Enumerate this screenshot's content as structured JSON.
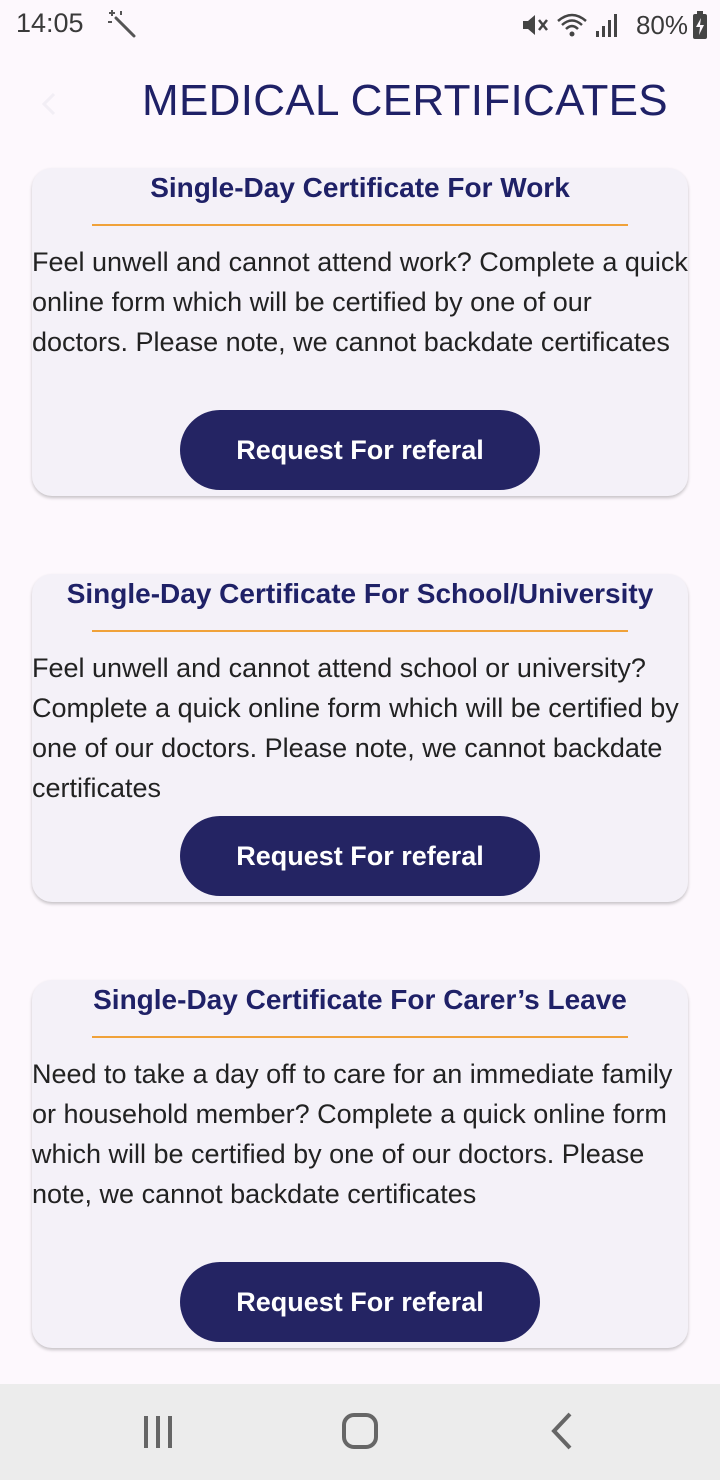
{
  "status_bar": {
    "time": "14:05",
    "battery": "80%",
    "icons": [
      "magic-wand-icon",
      "mute-icon",
      "wifi-icon",
      "signal-icon",
      "battery-charging-icon"
    ]
  },
  "app_bar": {
    "title": "MEDICAL CERTIFICATES",
    "back_icon": "back-arrow-icon"
  },
  "cards": [
    {
      "title": "Single-Day Certificate For Work",
      "description": "Feel unwell and cannot attend work? Complete a quick online form which will be certified by one of our doctors. Please note, we cannot backdate certificates",
      "button_label": "Request For referal"
    },
    {
      "title": "Single-Day Certificate For School/University",
      "description": "Feel unwell and cannot attend school or university? Complete a quick online form which will be certified by one of our doctors. Please note, we cannot backdate certificates",
      "button_label": "Request For referal"
    },
    {
      "title": "Single-Day Certificate For Carer’s Leave",
      "description": "Need to take a day off to care for an immediate family or household member? Complete a quick online form which will be certified by one of our doctors. Please note, we cannot backdate certificates",
      "button_label": "Request For referal"
    }
  ],
  "nav_bar": {
    "icons": [
      "recent-apps-icon",
      "home-icon",
      "back-icon"
    ]
  },
  "colors": {
    "accent": "#242463",
    "divider": "#f0a23a",
    "card_bg": "#f4f1f8",
    "page_bg": "#fdf8fd"
  }
}
